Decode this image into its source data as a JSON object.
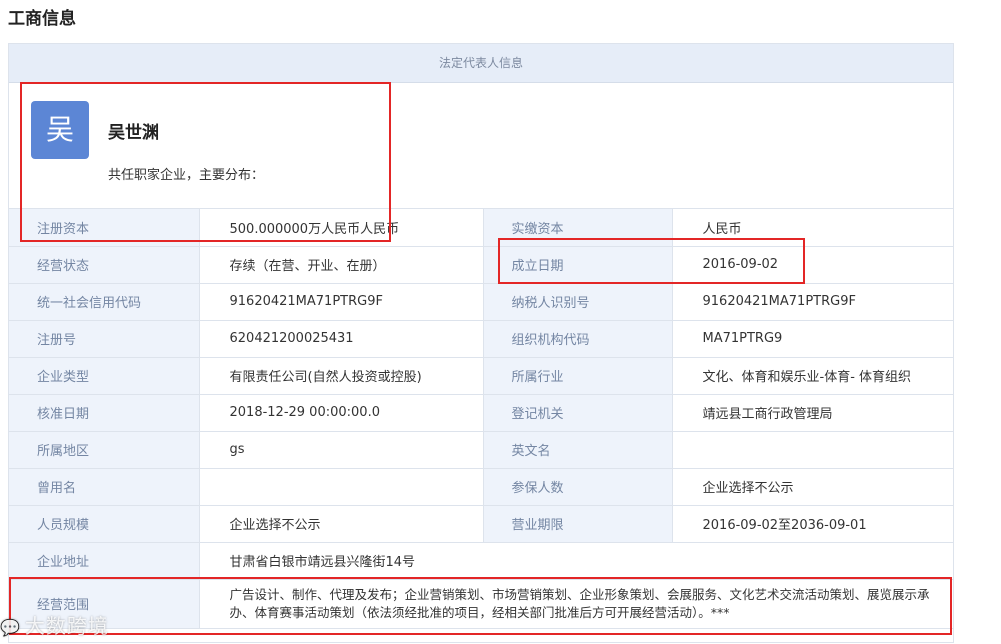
{
  "page": {
    "title": "工商信息"
  },
  "panel": {
    "header": "法定代表人信息"
  },
  "person": {
    "avatar_char": "吴",
    "name": "吴世渊",
    "distribution_text": "共任职家企业，主要分布："
  },
  "rows": [
    {
      "l1": "注册资本",
      "v1": "500.000000万人民币人民币",
      "l2": "实缴资本",
      "v2": "人民币"
    },
    {
      "l1": "经营状态",
      "v1": "存续（在营、开业、在册）",
      "l2": "成立日期",
      "v2": "2016-09-02"
    },
    {
      "l1": "统一社会信用代码",
      "v1": "91620421MA71PTRG9F",
      "l2": "纳税人识别号",
      "v2": "91620421MA71PTRG9F"
    },
    {
      "l1": "注册号",
      "v1": "620421200025431",
      "l2": "组织机构代码",
      "v2": "MA71PTRG9"
    },
    {
      "l1": "企业类型",
      "v1": "有限责任公司(自然人投资或控股)",
      "l2": "所属行业",
      "v2": "文化、体育和娱乐业-体育- 体育组织"
    },
    {
      "l1": "核准日期",
      "v1": "2018-12-29 00:00:00.0",
      "l2": "登记机关",
      "v2": "靖远县工商行政管理局"
    },
    {
      "l1": "所属地区",
      "v1": "gs",
      "l2": "英文名",
      "v2": ""
    },
    {
      "l1": "曾用名",
      "v1": "",
      "l2": "参保人数",
      "v2": "企业选择不公示"
    },
    {
      "l1": "人员规模",
      "v1": "企业选择不公示",
      "l2": "营业期限",
      "v2": "2016-09-02至2036-09-01"
    }
  ],
  "address": {
    "label": "企业地址",
    "value": "甘肃省白银市靖远县兴隆街14号"
  },
  "scope": {
    "label": "经营范围",
    "value": "广告设计、制作、代理及发布；企业营销策划、市场营销策划、企业形象策划、会展服务、文化艺术交流活动策划、展览展示承办、体育赛事活动策划（依法须经批准的项目，经相关部门批准后方可开展经营活动）。***"
  },
  "watermark": {
    "icon": "chat-bubble-icon",
    "text": "大数跨境"
  },
  "colors": {
    "highlight": "#e32626",
    "avatar": "#5c86d5",
    "label_bg": "#eef3fb",
    "header_bg": "#e6edf8"
  }
}
